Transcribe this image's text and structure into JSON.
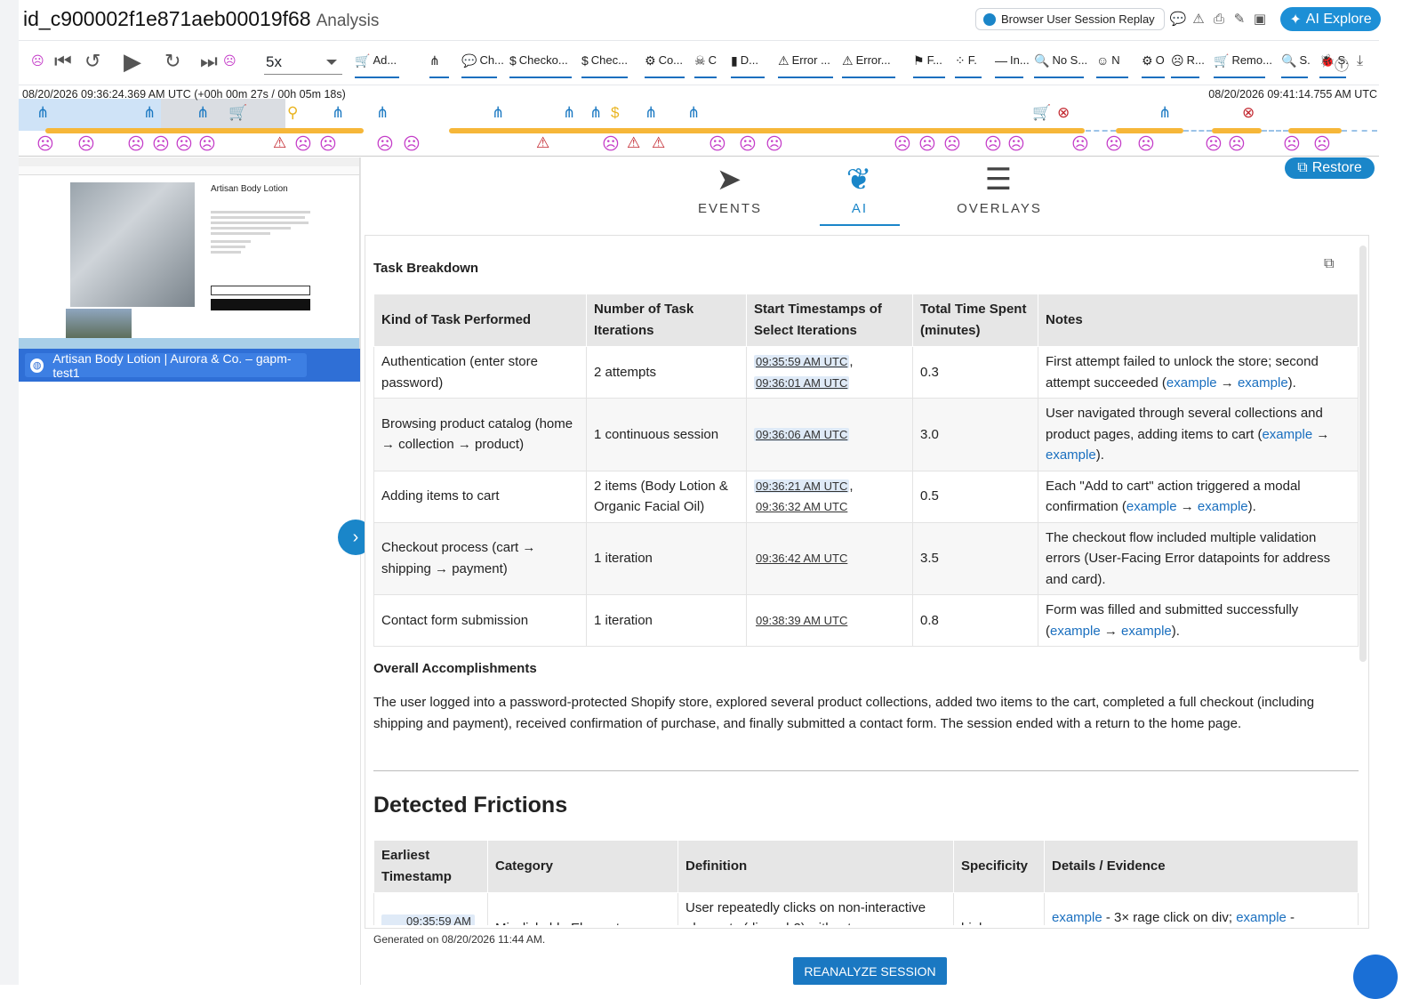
{
  "header": {
    "session_id": "id_c900002f1e871aeb00019f68",
    "section": "Analysis",
    "replay_button": "Browser User Session Replay",
    "ai_explore": "AI Explore"
  },
  "toolbar": {
    "speed": "5x",
    "events": [
      {
        "icon": "🛒",
        "label": "Ad..."
      },
      {
        "icon": "⋔",
        "label": ""
      },
      {
        "icon": "💬",
        "label": "Ch..."
      },
      {
        "icon": "$",
        "label": "Checko..."
      },
      {
        "icon": "$",
        "label": "Chec..."
      },
      {
        "icon": "⚙",
        "label": "Co..."
      },
      {
        "icon": "☠",
        "label": "C"
      },
      {
        "icon": "▮",
        "label": "D..."
      },
      {
        "icon": "⚠",
        "label": "Error ..."
      },
      {
        "icon": "⚠",
        "label": "Error..."
      },
      {
        "icon": "⚑",
        "label": "F..."
      },
      {
        "icon": "⁘",
        "label": "F."
      },
      {
        "icon": "—",
        "label": "In..."
      },
      {
        "icon": "🔍",
        "label": "No S..."
      },
      {
        "icon": "☺",
        "label": "N"
      },
      {
        "icon": "⚙",
        "label": "O"
      },
      {
        "icon": "☹",
        "label": "R..."
      },
      {
        "icon": "🛒",
        "label": "Remo..."
      },
      {
        "icon": "🔍",
        "label": "S."
      },
      {
        "icon": "🐞",
        "label": "S."
      }
    ]
  },
  "timeline": {
    "start": "08/20/2026 09:36:24.369 AM UTC (+00h 00m 27s / 00h 05m 18s)",
    "end": "08/20/2026 09:41:14.755 AM UTC"
  },
  "preview": {
    "product_title": "Artisan Body Lotion",
    "tab_title": "Artisan Body Lotion | Aurora & Co. – gapm-test1"
  },
  "tabs": {
    "restore": "Restore",
    "events": "EVENTS",
    "ai": "AI",
    "overlays": "OVERLAYS"
  },
  "task_breakdown": {
    "heading": "Task Breakdown",
    "columns": [
      "Kind of Task Performed",
      "Number of Task Iterations",
      "Start Timestamps of Select Iterations",
      "Total Time Spent (minutes)",
      "Notes"
    ],
    "rows": [
      {
        "kind": "Authentication (enter store password)",
        "iterations": "2 attempts",
        "ts": [
          "09:35:59 AM UTC",
          "09:36:01 AM UTC"
        ],
        "time": "0.3",
        "notes_pre": "First attempt failed to unlock the store; second attempt succeeded (",
        "notes_post": ")."
      },
      {
        "kind": "Browsing product catalog (home → collection → product)",
        "iterations": "1 continuous session",
        "ts": [
          "09:36:06 AM UTC"
        ],
        "time": "3.0",
        "notes_pre": "User navigated through several collections and product pages, adding items to cart (",
        "notes_post": ")."
      },
      {
        "kind": "Adding items to cart",
        "iterations": "2 items (Body Lotion & Organic Facial Oil)",
        "ts": [
          "09:36:21 AM UTC",
          "09:36:32 AM UTC"
        ],
        "time": "0.5",
        "notes_pre": "Each \"Add to cart\" action triggered a modal confirmation (",
        "notes_post": ")."
      },
      {
        "kind": "Checkout process (cart → shipping → payment)",
        "iterations": "1 iteration",
        "ts": [
          "09:36:42 AM UTC"
        ],
        "time": "3.5",
        "notes_pre": "The checkout flow included multiple validation errors (User-Facing Error datapoints for address and card).",
        "notes_post": ""
      },
      {
        "kind": "Contact form submission",
        "iterations": "1 iteration",
        "ts": [
          "09:38:39 AM UTC"
        ],
        "time": "0.8",
        "notes_pre": "Form was filled and submitted successfully (",
        "notes_post": ")."
      }
    ],
    "link_word": "example",
    "arrow": "→"
  },
  "accomplishments": {
    "heading": "Overall Accomplishments",
    "text": "The user logged into a password-protected Shopify store, explored several product collections, added two items to the cart, completed a full checkout (including shipping and payment), received confirmation of purchase, and finally submitted a contact form. The session ended with a return to the home page."
  },
  "frictions": {
    "heading": "Detected Frictions",
    "columns": [
      "Earliest Timestamp",
      "Category",
      "Definition",
      "Specificity",
      "Details / Evidence"
    ],
    "row": {
      "ts": "09:35:59 AM",
      "category": "Misclickable Element",
      "definition": "User repeatedly clicks on non-interactive elements (div, p, h2) without",
      "specificity": "high",
      "details_a": "example",
      "details_mid": " - 3× rage click on div; ",
      "details_b": "example",
      "details_end": " -"
    }
  },
  "footer": {
    "generated": "Generated on 08/20/2026 11:44 AM.",
    "reanalyze": "REANALYZE SESSION"
  }
}
